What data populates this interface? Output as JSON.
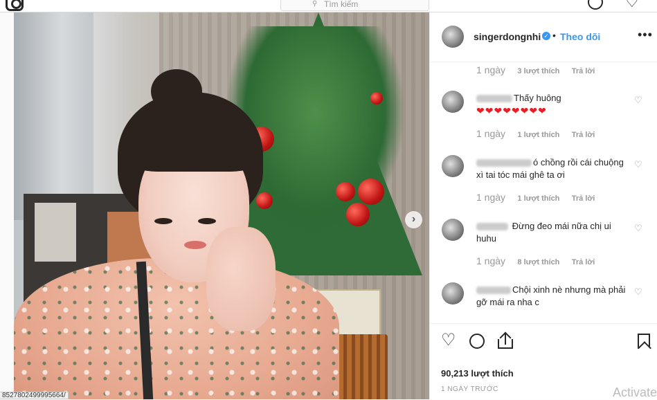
{
  "search": {
    "placeholder": "Tìm kiếm"
  },
  "post": {
    "username": "singerdongnhi",
    "follow_label": "Theo dõi",
    "more_label": "•••",
    "likes": "90,213 lượt thích",
    "time_ago": "1 NGÀY TRƯỚC",
    "next_label": "›"
  },
  "comments": [
    {
      "meta": {
        "time": "1 ngày",
        "likes": "3 lượt thích",
        "reply": "Trả lời"
      }
    },
    {
      "text": "Thấy huông",
      "hearts": "❤❤❤❤❤❤❤❤",
      "meta": {
        "time": "1 ngày",
        "likes": "1 lượt thích",
        "reply": "Trả lời"
      }
    },
    {
      "text": "ó chồng rồi cái chuộng xì tai tóc mái ghê ta ơi",
      "meta": {
        "time": "1 ngày",
        "likes": "1 lượt thích",
        "reply": "Trả lời"
      }
    },
    {
      "text": "Đừng đeo mái nữa chị ui huhu",
      "meta": {
        "time": "1 ngày",
        "likes": "8 lượt thích",
        "reply": "Trả lời"
      }
    },
    {
      "text": "Chội xinh nè nhưng mà phải gỡ mái ra nha c"
    }
  ],
  "status_url": "8527802499995664/",
  "watermark": "Activate",
  "colors": {
    "link": "#3897f0",
    "heart": "#ed1c24"
  }
}
